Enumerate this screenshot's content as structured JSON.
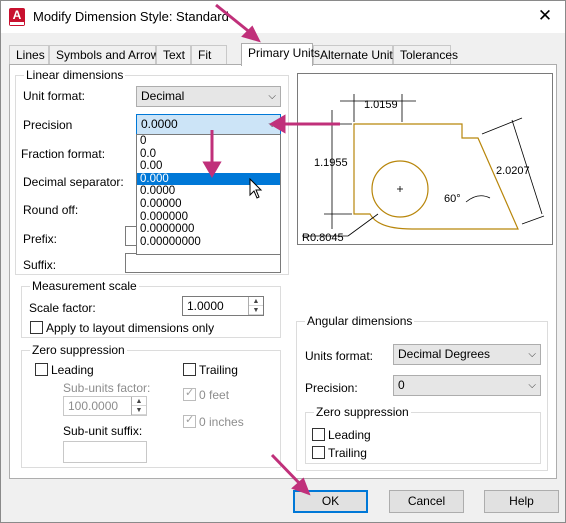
{
  "window": {
    "title": "Modify Dimension Style: Standard",
    "app_icon_letter": "A",
    "close_glyph": "✕"
  },
  "tabs": [
    "Lines",
    "Symbols and Arrows",
    "Text",
    "Fit",
    "Primary Units",
    "Alternate Units",
    "Tolerances"
  ],
  "active_tab": "Primary Units",
  "linear": {
    "group_label": "Linear dimensions",
    "unit_format_label": "Unit format:",
    "unit_format_value": "Decimal",
    "precision_label": "Precision",
    "precision_value": "0.0000",
    "precision_options": [
      "0",
      "0.0",
      "0.00",
      "0.000",
      "0.0000",
      "0.00000",
      "0.000000",
      "0.0000000",
      "0.00000000"
    ],
    "precision_highlighted": "0.000",
    "fraction_format_label": "Fraction format:",
    "decimal_separator_label": "Decimal separator:",
    "round_off_label": "Round off:",
    "prefix_label": "Prefix:",
    "suffix_label": "Suffix:"
  },
  "measurement": {
    "group_label": "Measurement scale",
    "scale_factor_label": "Scale factor:",
    "scale_factor_value": "1.0000",
    "apply_layout_label": "Apply to layout dimensions only"
  },
  "zero_suppression": {
    "group_label": "Zero suppression",
    "leading_label": "Leading",
    "trailing_label": "Trailing",
    "subunits_factor_label": "Sub-units factor:",
    "subunits_factor_value": "100.0000",
    "zero_feet_label": "0 feet",
    "zero_inches_label": "0 inches",
    "subunit_suffix_label": "Sub-unit suffix:"
  },
  "preview": {
    "dim_top": "1.0159",
    "dim_left": "1.1955",
    "dim_right": "2.0207",
    "angle": "60°",
    "radius": "R0.8045"
  },
  "angular": {
    "group_label": "Angular dimensions",
    "units_format_label": "Units format:",
    "units_format_value": "Decimal Degrees",
    "precision_label": "Precision:",
    "precision_value": "0",
    "zero_group_label": "Zero suppression",
    "leading_label": "Leading",
    "trailing_label": "Trailing"
  },
  "buttons": {
    "ok": "OK",
    "cancel": "Cancel",
    "help": "Help"
  },
  "colors": {
    "accent": "#0078d7",
    "annotation_arrow": "#c0307a",
    "preview_outline": "#b8860b"
  }
}
